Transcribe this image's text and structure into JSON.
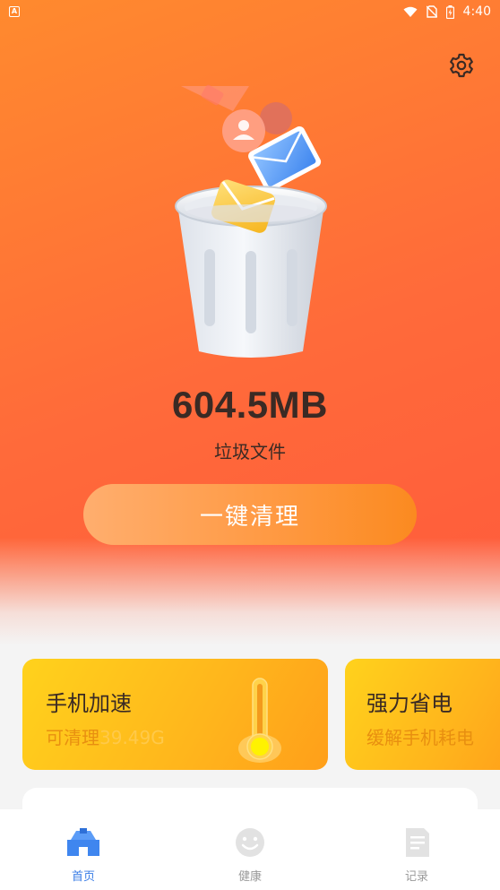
{
  "status_bar": {
    "app_indicator": "A",
    "time": "4:40",
    "icons": [
      "wifi-icon",
      "no-sim-icon",
      "battery-icon"
    ]
  },
  "header": {
    "settings_icon": "gear-icon"
  },
  "hero": {
    "illustration": "trash-can-icon",
    "amount": "604.5MB",
    "amount_label": "垃圾文件",
    "clean_button_label": "一键清理"
  },
  "cards": [
    {
      "title": "手机加速",
      "subtitle_prefix": "可清理",
      "subtitle_value": "39.49G",
      "icon": "thermometer-icon"
    },
    {
      "title": "强力省电",
      "subtitle": "缓解手机耗电"
    }
  ],
  "tabs": [
    {
      "label": "首页",
      "icon": "home-icon",
      "active": true
    },
    {
      "label": "健康",
      "icon": "smiley-icon",
      "active": false
    },
    {
      "label": "记录",
      "icon": "document-icon",
      "active": false
    }
  ],
  "colors": {
    "hero_start": "#ff8a2e",
    "hero_end": "#ff5a3c",
    "card_yellow": "#ffc21c",
    "tab_active": "#3a7de6",
    "tab_inactive": "#9a9a9a",
    "text_dark": "#3a2a24"
  }
}
